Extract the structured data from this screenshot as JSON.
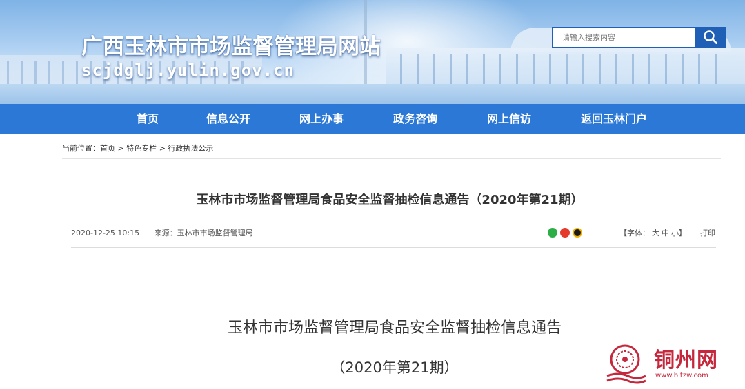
{
  "header": {
    "site_title": "广西玉林市市场监督管理局网站",
    "site_domain": "scjdglj.yulin.gov.cn",
    "search_placeholder": "请输入搜索内容",
    "search_icon": "search-icon"
  },
  "nav": {
    "items": [
      {
        "label": "首页"
      },
      {
        "label": "信息公开"
      },
      {
        "label": "网上办事"
      },
      {
        "label": "政务咨询"
      },
      {
        "label": "网上信访"
      },
      {
        "label": "返回玉林门户"
      }
    ]
  },
  "breadcrumb": {
    "prefix": "当前位置：",
    "items": [
      "首页",
      "特色专栏",
      "行政执法公示"
    ],
    "separator": ">"
  },
  "article": {
    "title": "玉林市市场监督管理局食品安全监督抽检信息通告（2020年第21期）",
    "date": "2020-12-25 10:15",
    "source_label": "来源：",
    "source": "玉林市市场监督管理局",
    "font_size_label": "【字体：",
    "font_sizes": [
      "大",
      "中",
      "小"
    ],
    "font_size_close": "】",
    "print_label": "打印",
    "share_icons": [
      "wechat-icon",
      "weibo-icon",
      "qq-icon"
    ],
    "body_heading": "玉林市市场监督管理局食品安全监督抽检信息通告",
    "body_issue": "（2020年第21期）"
  },
  "watermark": {
    "text": "铜州网",
    "url": "www.bltzw.com"
  },
  "colors": {
    "nav_bg": "#2b78d6",
    "search_btn": "#1f5fb5",
    "watermark": "#c5283d"
  }
}
